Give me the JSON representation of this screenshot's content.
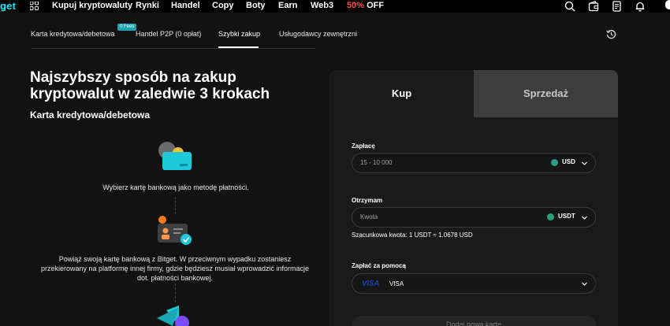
{
  "brand": {
    "logo_text": "get",
    "accent": "#00F0FF"
  },
  "nav": {
    "items": [
      "Kupuj kryptowaluty",
      "Rynki",
      "Handel",
      "Copy",
      "Boty",
      "Earn",
      "Web3"
    ],
    "promo_pct": "50%",
    "promo_word": "OFF",
    "icons": [
      "search-icon",
      "wallet-icon",
      "orders-icon",
      "bell-icon"
    ]
  },
  "subnav": {
    "tabs": [
      "Karta kredytowa/debetowa",
      "Handel P2P (0 opłat)",
      "Szybki zakup",
      "Usługodawcy zewnętrzni"
    ],
    "active_tab": "Szybki zakup",
    "badge": "0 Fees"
  },
  "hero": {
    "headline": "Najszybszy sposób na zakup kryptowalut w zaledwie 3 krokach",
    "subhead": "Karta kredytowa/debetowa"
  },
  "steps": [
    {
      "text": "Wybierz kartę bankową jako metodę płatności.",
      "icon": "card-icon"
    },
    {
      "text": "Powiąż swoją kartę bankową z Bitget. W przeciwnym wypadku zostaniesz przekierowany na platformę innej firmy, gdzie będziesz musiał wprowadzić informacje dot. płatności bankowej.",
      "icon": "verified-id-icon"
    },
    {
      "text": "",
      "icon": "send-icon"
    }
  ],
  "form": {
    "tab_buy": "Kup",
    "tab_sell": "Sprzedaż",
    "pay_label": "Zapłacę",
    "pay_placeholder": "15 - 10 000",
    "pay_currency": "USD",
    "receive_label": "Otrzymam",
    "receive_placeholder": "Kwota",
    "receive_currency": "USDT",
    "estimate": "Szacunkowa kwota: 1 USDT ≈ 1.0678 USD",
    "method_label": "Zapłać za pomocą",
    "method_logo": "VISA",
    "method_value": "VISA",
    "add_card": "Dodaj nową kartę"
  },
  "colors": {
    "usd": "#2E9C8C",
    "usdt": "#26A17B",
    "visa": "#1A3FB2",
    "promo": "#FF4D4D"
  }
}
